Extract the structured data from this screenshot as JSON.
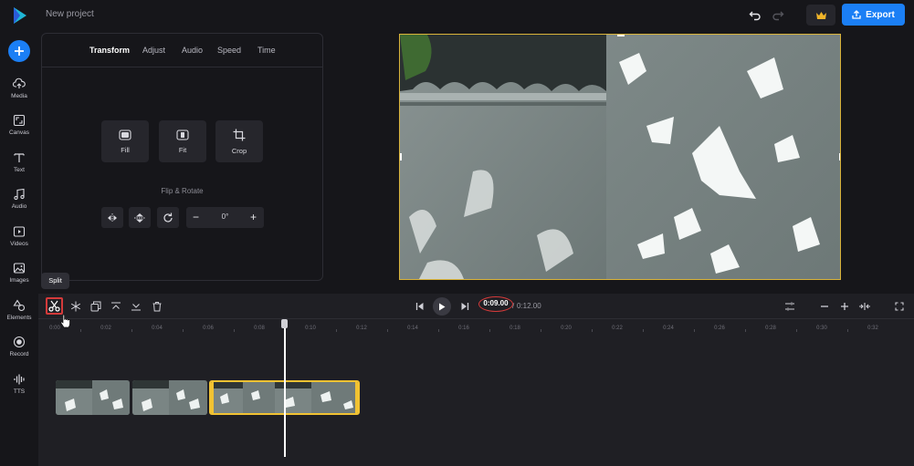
{
  "app": {
    "project_title": "New project",
    "export_label": "Export",
    "colors": {
      "accent": "#1b7ff5",
      "selection": "#f1c232",
      "annotation": "#d43a3a"
    }
  },
  "rail": {
    "items": [
      {
        "label": "Media",
        "icon": "cloud-upload-icon"
      },
      {
        "label": "Canvas",
        "icon": "canvas-icon"
      },
      {
        "label": "Text",
        "icon": "text-icon"
      },
      {
        "label": "Audio",
        "icon": "music-note-icon"
      },
      {
        "label": "Videos",
        "icon": "video-icon"
      },
      {
        "label": "Images",
        "icon": "image-icon"
      },
      {
        "label": "Elements",
        "icon": "shapes-icon"
      },
      {
        "label": "Record",
        "icon": "record-icon"
      },
      {
        "label": "TTS",
        "icon": "waveform-icon"
      }
    ]
  },
  "panel": {
    "tabs": [
      "Transform",
      "Adjust",
      "Audio",
      "Speed",
      "Time"
    ],
    "active_tab": "Transform",
    "tools": [
      "Fill",
      "Fit",
      "Crop"
    ],
    "flip_rotate_title": "Flip & Rotate",
    "rotation": "0°"
  },
  "timeline": {
    "tooltip": "Split",
    "current_time": "0:09.00",
    "separator": "/",
    "total_time": "0:12.00",
    "ticks": [
      "0:00",
      "0:02",
      "0:04",
      "0:06",
      "0:08",
      "0:10",
      "0:12",
      "0:14",
      "0:16",
      "0:18",
      "0:20",
      "0:22",
      "0:24",
      "0:26",
      "0:28",
      "0:30",
      "0:32"
    ]
  }
}
